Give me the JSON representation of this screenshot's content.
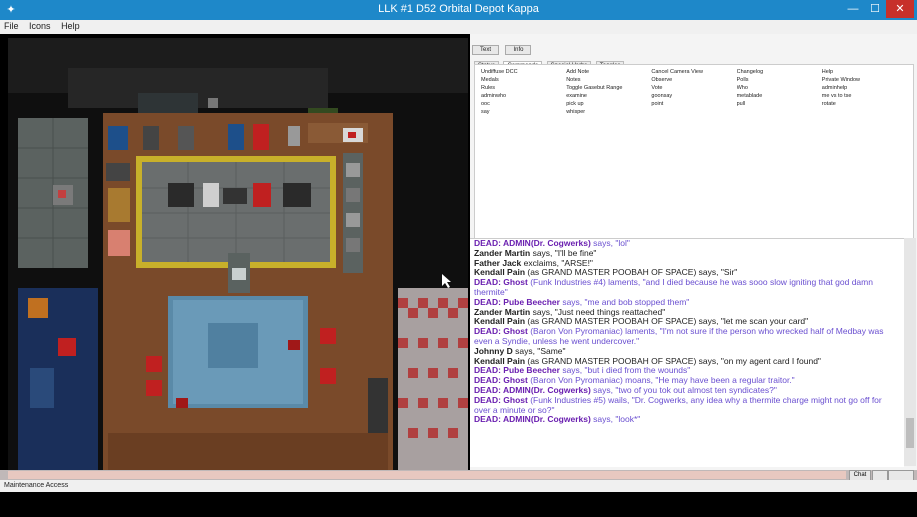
{
  "window": {
    "title": "LLK #1 D52 Orbital Depot Kappa",
    "app_icon": "space-station-icon",
    "minimize_icon": "minimize-icon",
    "maximize_icon": "maximize-icon",
    "close_icon": "close-icon"
  },
  "menu": [
    "File",
    "Icons",
    "Help"
  ],
  "top_buttons": [
    "Text",
    "Info"
  ],
  "tabs": [
    "Status",
    "Commands",
    "Special Verbs",
    "Toggles"
  ],
  "commands": [
    "Undiffuse DCC",
    "Add Note",
    "Cancel Camera View",
    "Changelog",
    "Help",
    "Medals",
    "Notes",
    "Observe",
    "Polls",
    "Private Window",
    "Rules",
    "Toggle Gasebut Range",
    "Vote",
    "Who",
    "adminhelp",
    "adminwho",
    "examine",
    "goonsay",
    "metablade",
    "me vs to tse",
    "ooc",
    "pick up",
    "point",
    "pull",
    "rotate",
    "say",
    "whisper"
  ],
  "chat": [
    {
      "speaker": "DEAD: ADMIN(Dr. Cogwerks)",
      "dead": true,
      "verb": " says, ",
      "text": "\"lol\""
    },
    {
      "speaker": "Zander Martin",
      "dead": false,
      "verb": " says, ",
      "text": "\"I'll be fine\""
    },
    {
      "speaker": "Father Jack",
      "dead": false,
      "verb": " exclaims, ",
      "text": "\"ARSE!\""
    },
    {
      "speaker": "Kendall Pain",
      "dead": false,
      "verb": " (as GRAND MASTER POOBAH OF SPACE) says, ",
      "text": "\"Sir\""
    },
    {
      "speaker": "DEAD: Ghost",
      "dead": true,
      "verb": " (Funk Industries #4) laments, ",
      "text": "\"and I died because he was sooo slow igniting that god damn thermite\""
    },
    {
      "speaker": "DEAD: Pube Beecher",
      "dead": true,
      "verb": " says, ",
      "text": "\"me and bob stopped them\""
    },
    {
      "speaker": "Zander Martin",
      "dead": false,
      "verb": " says, ",
      "text": "\"Just need things reattached\""
    },
    {
      "speaker": "Kendall Pain",
      "dead": false,
      "verb": " (as GRAND MASTER POOBAH OF SPACE) says, ",
      "text": "\"let me scan your card\""
    },
    {
      "speaker": "DEAD: Ghost",
      "dead": true,
      "verb": " (Baron Von Pyromaniac) laments, ",
      "text": "\"I'm not sure if the person who wrecked half of Medbay was even a Syndie, unless he went undercover.\""
    },
    {
      "speaker": "Johnny D",
      "dead": false,
      "verb": " says, ",
      "text": "\"Same\""
    },
    {
      "speaker": "Kendall Pain",
      "dead": false,
      "verb": " (as GRAND MASTER POOBAH OF SPACE) says, ",
      "text": "\"on my agent card I found\""
    },
    {
      "speaker": "DEAD: Pube Beecher",
      "dead": true,
      "verb": " says, ",
      "text": "\"but i died from the wounds\""
    },
    {
      "speaker": "DEAD: Ghost",
      "dead": true,
      "verb": " (Baron Von Pyromaniac) moans, ",
      "text": "\"He may have been a regular traitor.\""
    },
    {
      "speaker": "DEAD: ADMIN(Dr. Cogwerks)",
      "dead": true,
      "verb": " says, ",
      "text": "\"two of you tok out almost ten syndicates?\""
    },
    {
      "speaker": "DEAD: Ghost",
      "dead": true,
      "verb": " (Funk Industries #5) wails, ",
      "text": "\"Dr. Cogwerks, any idea why a thermite charge might not go off for over a minute or so?\""
    },
    {
      "speaker": "DEAD: ADMIN(Dr. Cogwerks)",
      "dead": true,
      "verb": " says, ",
      "text": "\"look*\""
    }
  ],
  "chat_button": "Chat",
  "status_bar": "Maintenance Access",
  "colors": {
    "titlebar": "#1e88c9",
    "dead": "#6a1fb0",
    "floor": "#7a4a2a",
    "table": "#5a8aa8"
  }
}
